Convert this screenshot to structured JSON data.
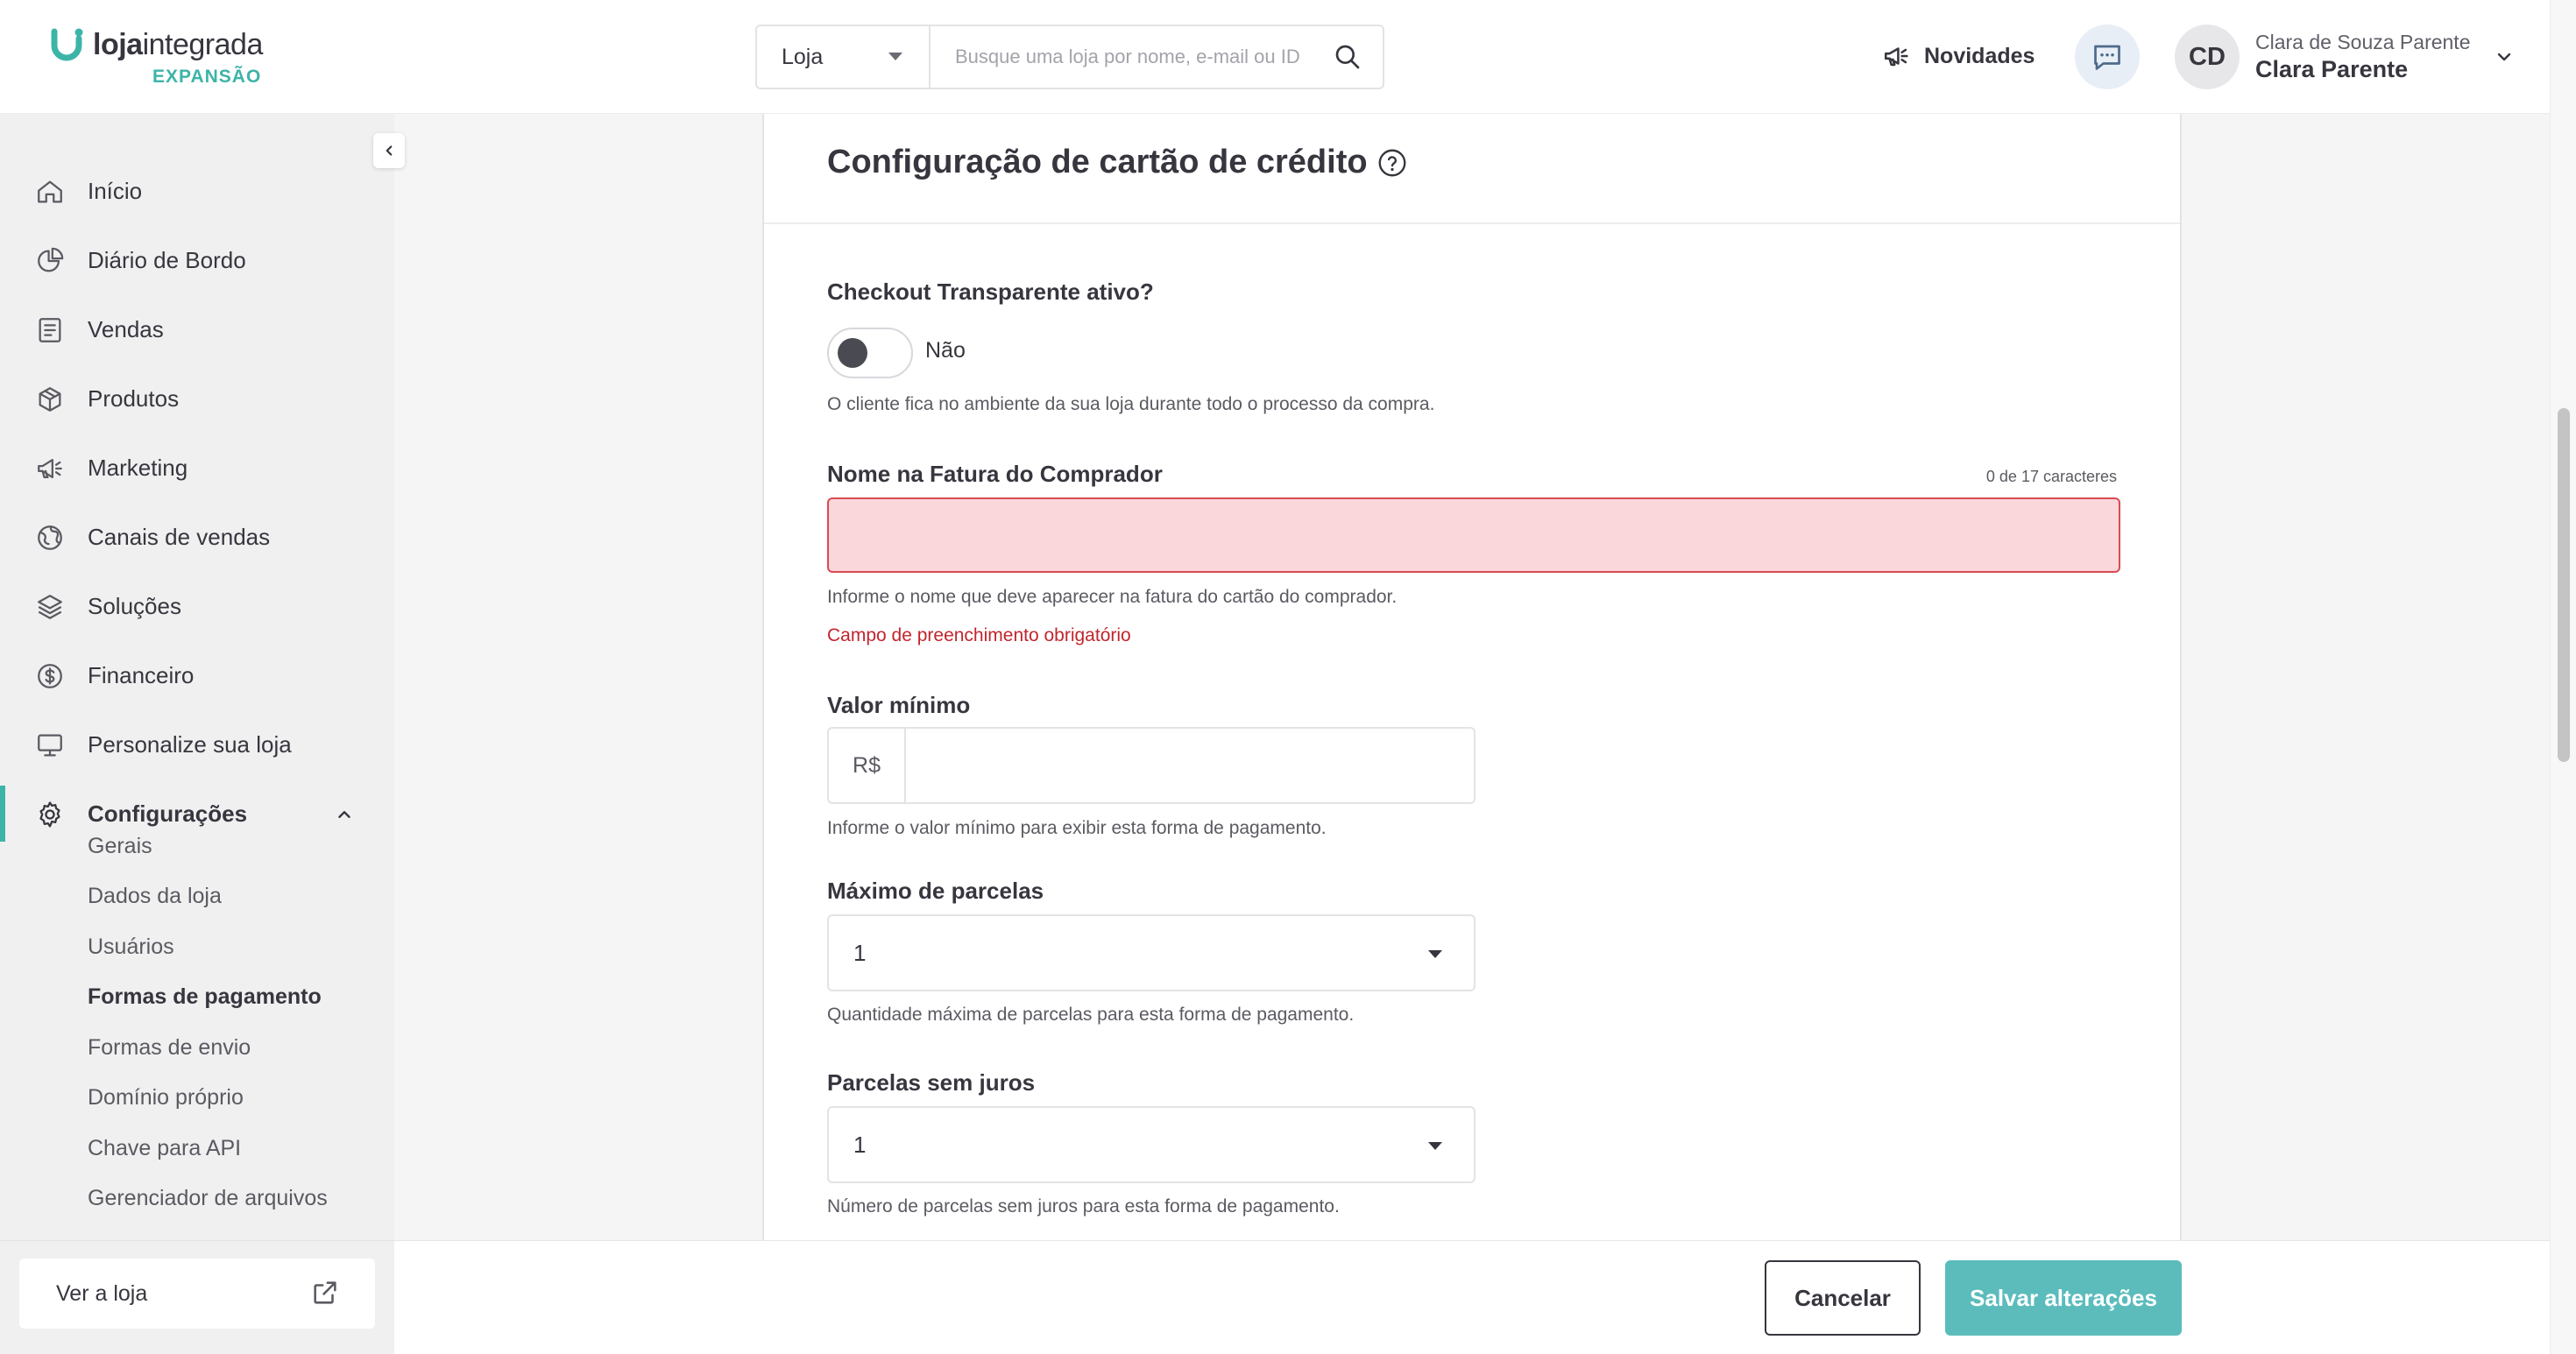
{
  "brand": {
    "name_bold": "loja",
    "name_regular": "integrada",
    "plan": "EXPANSÃO",
    "accent": "#3db4a8"
  },
  "header": {
    "search_scope": "Loja",
    "search_placeholder": "Busque uma loja por nome, e-mail ou ID",
    "news_label": "Novidades",
    "user_initials": "CD",
    "user_full_name": "Clara de Souza Parente",
    "user_short_name": "Clara Parente"
  },
  "sidebar": {
    "items": [
      {
        "label": "Início",
        "icon": "home-icon"
      },
      {
        "label": "Diário de Bordo",
        "icon": "pie-chart-icon"
      },
      {
        "label": "Vendas",
        "icon": "receipt-icon"
      },
      {
        "label": "Produtos",
        "icon": "box-icon"
      },
      {
        "label": "Marketing",
        "icon": "megaphone-icon"
      },
      {
        "label": "Canais de vendas",
        "icon": "globe-icon"
      },
      {
        "label": "Soluções",
        "icon": "layers-icon"
      },
      {
        "label": "Financeiro",
        "icon": "dollar-circle-icon"
      },
      {
        "label": "Personalize sua loja",
        "icon": "monitor-icon"
      },
      {
        "label": "Configurações",
        "icon": "gear-icon"
      }
    ],
    "sub_items": [
      "Gerais",
      "Dados da loja",
      "Usuários",
      "Formas de pagamento",
      "Formas de envio",
      "Domínio próprio",
      "Chave para API",
      "Gerenciador de arquivos"
    ],
    "view_store": "Ver a loja"
  },
  "form": {
    "title": "Configuração de cartão de crédito",
    "checkout_label": "Checkout Transparente ativo?",
    "checkout_toggle_state": "Não",
    "checkout_help": "O cliente fica no ambiente da sua loja durante todo o processo da compra.",
    "invoice_label": "Nome na Fatura do Comprador",
    "invoice_counter": "0 de 17 caracteres",
    "invoice_value": "",
    "invoice_help": "Informe o nome que deve aparecer na fatura do cartão do comprador.",
    "invoice_error": "Campo de preenchimento obrigatório",
    "min_label": "Valor mínimo",
    "min_prefix": "R$",
    "min_value": "",
    "min_help": "Informe o valor mínimo para exibir esta forma de pagamento.",
    "max_installments_label": "Máximo de parcelas",
    "max_installments_value": "1",
    "max_installments_help": "Quantidade máxima de parcelas para esta forma de pagamento.",
    "free_installments_label": "Parcelas sem juros",
    "free_installments_value": "1",
    "free_installments_help": "Número de parcelas sem juros para esta forma de pagamento."
  },
  "footer": {
    "cancel_label": "Cancelar",
    "save_label": "Salvar alterações"
  }
}
